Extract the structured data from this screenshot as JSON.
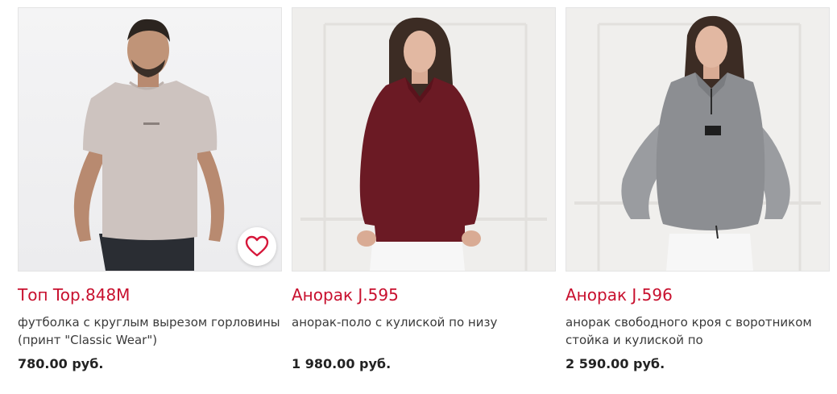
{
  "products": [
    {
      "title": "Топ Top.848M",
      "description": "футболка с круглым вырезом горловины (принт \"Classic Wear\")",
      "price": "780.00 руб.",
      "image_icon": "tshirt-model-photo",
      "favorite_icon": "heart-icon"
    },
    {
      "title": "Анорак J.595",
      "description": "анорак-поло с кулиской по низу",
      "price": "1 980.00 руб.",
      "image_icon": "burgundy-anorak-photo"
    },
    {
      "title": "Анорак J.596",
      "description": "анорак свободного кроя с воротником стойка и кулиской по",
      "price": "2 590.00 руб.",
      "image_icon": "grey-fleece-anorak-photo"
    }
  ],
  "colors": {
    "title": "#c8102e",
    "heart": "#d6173a",
    "burgundy": "#6b1a24",
    "grey_fleece": "#8c8e92",
    "tshirt": "#cdc3bf"
  }
}
